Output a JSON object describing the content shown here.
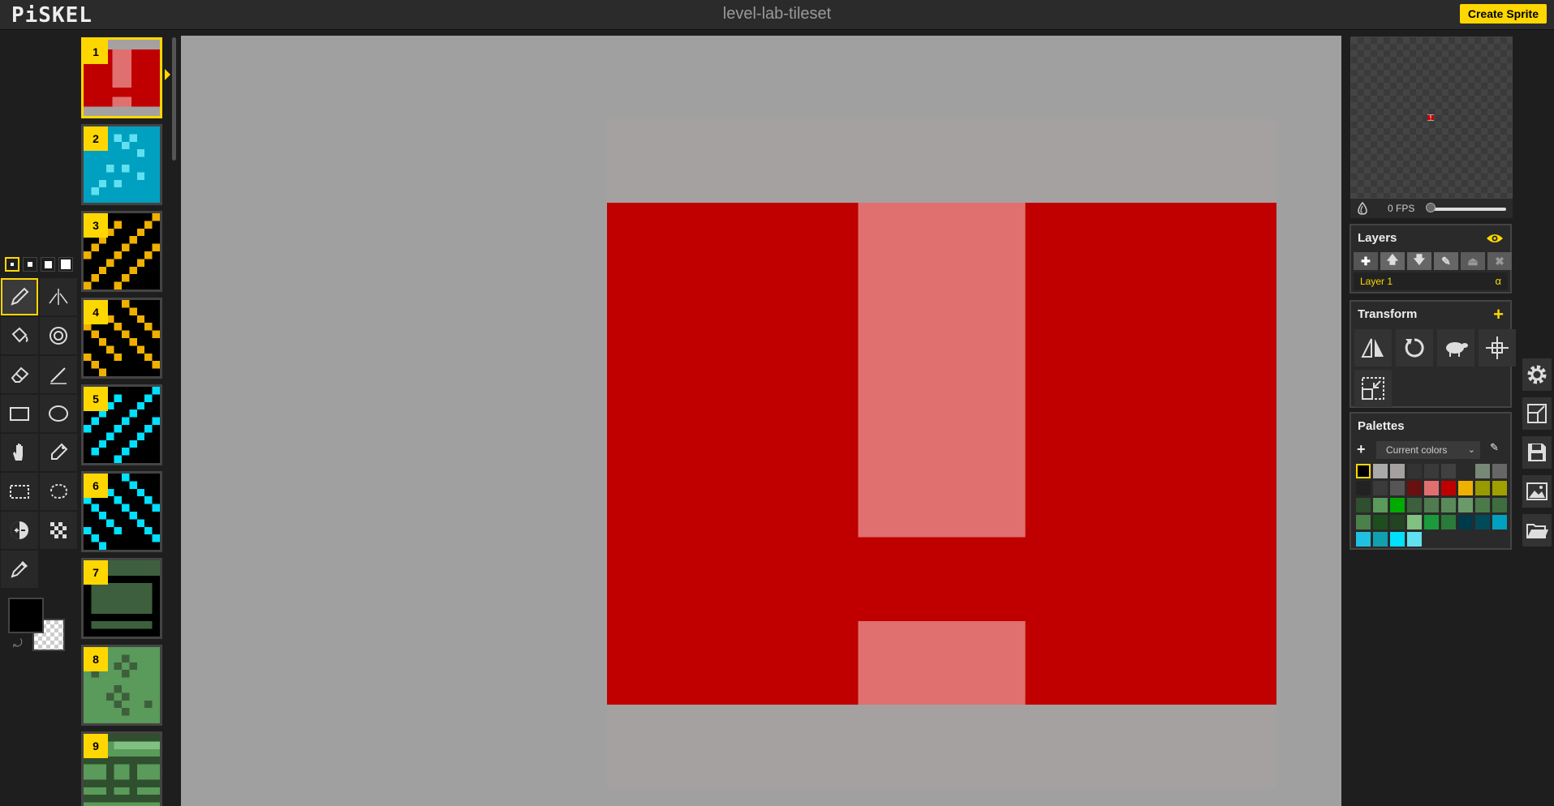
{
  "app": {
    "logo": "PiSKEL",
    "sprite_title": "level-lab-tileset",
    "create_button": "Create Sprite"
  },
  "tools": {
    "pen_sizes": [
      1,
      2,
      3,
      4
    ],
    "active_pen_size": 1,
    "items": [
      {
        "name": "pen-tool-icon",
        "active": true
      },
      {
        "name": "vertical-mirror-pen-icon"
      },
      {
        "name": "paint-bucket-icon"
      },
      {
        "name": "paint-all-same-color-icon"
      },
      {
        "name": "eraser-icon"
      },
      {
        "name": "stroke-icon"
      },
      {
        "name": "rectangle-icon"
      },
      {
        "name": "circle-icon"
      },
      {
        "name": "move-hand-icon"
      },
      {
        "name": "shape-selection-icon"
      },
      {
        "name": "rectangle-selection-icon"
      },
      {
        "name": "lasso-selection-icon"
      },
      {
        "name": "lighten-icon"
      },
      {
        "name": "dithering-icon"
      },
      {
        "name": "color-picker-icon"
      }
    ],
    "primary_color": "#000000",
    "secondary_color": "transparent"
  },
  "frames": [
    {
      "number": "1",
      "active": true
    },
    {
      "number": "2"
    },
    {
      "number": "3"
    },
    {
      "number": "4"
    },
    {
      "number": "5"
    },
    {
      "number": "6"
    },
    {
      "number": "7"
    },
    {
      "number": "8"
    },
    {
      "number": "9"
    }
  ],
  "canvas": {
    "background": "#a5a1a1",
    "red": "#c00000",
    "pink": "#e07070"
  },
  "preview": {
    "fps_label": "0 FPS",
    "fps_value": 0
  },
  "layers": {
    "title": "Layers",
    "items": [
      {
        "name": "Layer 1",
        "alpha_label": "α"
      }
    ]
  },
  "transform": {
    "title": "Transform"
  },
  "palettes": {
    "title": "Palettes",
    "selected": "Current colors",
    "colors": [
      "#000000",
      "#aaaaaa",
      "#a5a1a1",
      "#333333",
      "#3a3a3a",
      "#404040",
      "#2a2a2a",
      "#778877",
      "#666666",
      "#222222",
      "#3b3b3b",
      "#555555",
      "#6b1010",
      "#e07070",
      "#c00000",
      "#f0b000",
      "#999900",
      "#a0a000",
      "#2f4f2f",
      "#5a9a5a",
      "#00aa00",
      "#3d5f3d",
      "#507a50",
      "#5a8a5a",
      "#6a9a6a",
      "#4a7a4a",
      "#3e6e3e",
      "#4a804a",
      "#1e4e1e",
      "#224422",
      "#80c080",
      "#1a9a3a",
      "#2a7a3a",
      "#003a4a",
      "#004a5a",
      "#00a0c0",
      "#20c0e0",
      "#10a0b0",
      "#00e0ff",
      "#60e0f0"
    ]
  }
}
